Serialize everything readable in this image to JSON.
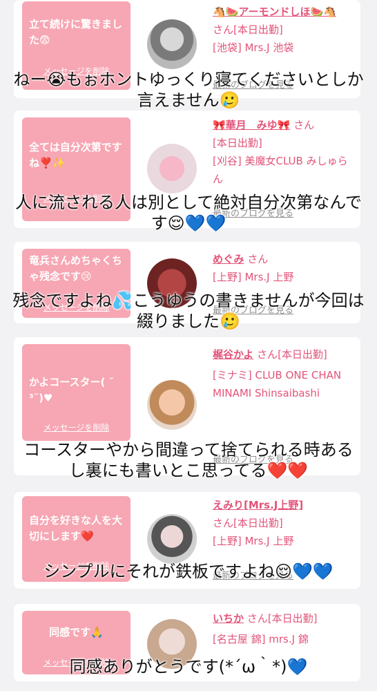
{
  "cards": [
    {
      "message": "立て続けに驚きました😨",
      "delete_label": "メッセージを削除",
      "name_line": "🐴🍉アーモンドしほ🍉🐴",
      "san": "さん",
      "status": "[本日出勤]",
      "shop": "[池袋] Mrs.J 池袋",
      "blog_link": "最新のブログを見る",
      "caption": "ねー😭もぉホントゆっくり寝てくださいとしか言えません🥲"
    },
    {
      "message": "全ては自分次第ですね❣️✨",
      "delete_label": "メッセージを削除",
      "name_line": "🎀華月　みゆ🎀",
      "san": "さん",
      "status": "[本日出勤]",
      "shop": "[刈谷] 美魔女CLUB みしゅらん",
      "blog_link": "最新のブログを見る",
      "caption": "人に流される人は別として絶対自分次第なんです😌💙💙"
    },
    {
      "message": "竜兵さんめちゃくちゃ残念です😢",
      "delete_label": "メッセージを削除",
      "name_line": "めぐみ",
      "san": "さん",
      "status": "",
      "shop": "[上野] Mrs.J 上野",
      "blog_link": "最新のブログを見る",
      "caption": "残念ですよね💦こうゆうの書きませんが今回は綴りました🥲"
    },
    {
      "message": "かよコースター( ˘ ³˘)♥",
      "delete_label": "メッセージを削除",
      "name_line": "梶谷かよ",
      "san": "さん",
      "status": "[本日出勤]",
      "shop": "[ミナミ] CLUB ONE CHAN MINAMI Shinsaibashi",
      "blog_link": "最新のブログを見る",
      "caption": "コースターやから間違って捨てられる時あるし裏にも書いとこ思ってる❤️❤️"
    },
    {
      "message": "自分を好きな人を大切にします❤️",
      "delete_label": "メッセージを削除",
      "name_line": "えみり[Mrs.J上野]",
      "san": "さん",
      "status": "[本日出勤]",
      "shop": "[上野] Mrs.J 上野",
      "blog_link": "最新のブログを見る",
      "caption": "シンプルにそれが鉄板ですよね😌💙💙"
    },
    {
      "message": "同感です🙏",
      "delete_label": "メッセージを削除",
      "name_line": "いちか",
      "san": "さん",
      "status": "[本日出勤]",
      "shop": "[名古屋 錦] mrs.J 錦",
      "blog_link": "",
      "caption": "同感ありがとうです(*´ω｀*)💙"
    }
  ]
}
